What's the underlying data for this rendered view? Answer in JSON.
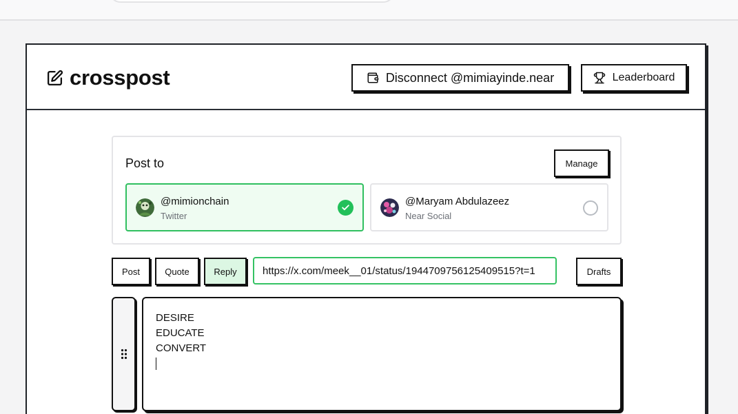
{
  "header": {
    "brand": "crosspost",
    "disconnect_label": "Disconnect @mimiayinde.near",
    "leaderboard_label": "Leaderboard"
  },
  "post_to": {
    "title": "Post to",
    "manage_label": "Manage",
    "accounts": [
      {
        "handle": "@mimionchain",
        "platform": "Twitter",
        "selected": true
      },
      {
        "handle": "@Maryam Abdulazeez",
        "platform": "Near Social",
        "selected": false
      }
    ]
  },
  "modes": {
    "post_label": "Post",
    "quote_label": "Quote",
    "reply_label": "Reply",
    "active": "Reply",
    "drafts_label": "Drafts"
  },
  "reply_url": {
    "value": "https://x.com/meek__01/status/1944709756125409515?t=1"
  },
  "editor": {
    "lines": [
      "DESIRE",
      "EDUCATE",
      "CONVERT"
    ]
  },
  "colors": {
    "selected_border": "#2fbf5f",
    "selected_bg": "#effcf2",
    "check": "#22c05a",
    "reply_active_bg": "#dcf7e3"
  },
  "icons": {
    "brand": "edit-icon",
    "disconnect": "wallet-icon",
    "leaderboard": "trophy-icon",
    "drag": "grip-vertical-icon",
    "check": "check-circle-icon"
  }
}
